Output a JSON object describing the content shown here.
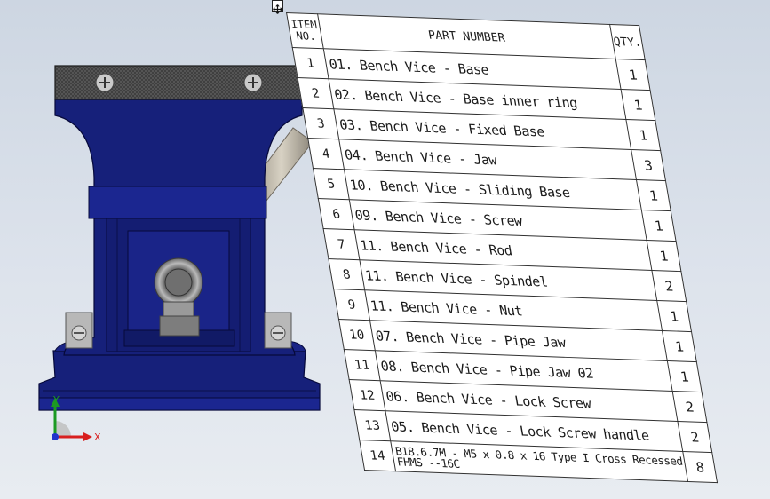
{
  "viewport": {
    "background": "#d8dfe8",
    "model_color": "#15207a",
    "axis_labels": {
      "x": "X",
      "y": "Y"
    },
    "axis_colors": {
      "x": "#d81f1f",
      "y": "#1c9a23",
      "z": "#2233cc"
    }
  },
  "bom": {
    "headers": {
      "item_line1": "ITEM",
      "item_line2": "NO.",
      "part": "PART NUMBER",
      "qty": "QTY."
    },
    "rows": [
      {
        "item": "1",
        "part": "01. Bench Vice - Base",
        "qty": "1"
      },
      {
        "item": "2",
        "part": "02. Bench Vice - Base inner ring",
        "qty": "1"
      },
      {
        "item": "3",
        "part": "03. Bench Vice - Fixed Base",
        "qty": "1"
      },
      {
        "item": "4",
        "part": "04. Bench Vice - Jaw",
        "qty": "3"
      },
      {
        "item": "5",
        "part": "10. Bench Vice - Sliding Base",
        "qty": "1"
      },
      {
        "item": "6",
        "part": "09. Bench Vice - Screw",
        "qty": "1"
      },
      {
        "item": "7",
        "part": "11. Bench Vice - Rod",
        "qty": "1"
      },
      {
        "item": "8",
        "part": "11. Bench Vice - Spindel",
        "qty": "2"
      },
      {
        "item": "9",
        "part": "11. Bench Vice - Nut",
        "qty": "1"
      },
      {
        "item": "10",
        "part": "07. Bench Vice - Pipe Jaw",
        "qty": "1"
      },
      {
        "item": "11",
        "part": "08. Bench Vice - Pipe Jaw 02",
        "qty": "1"
      },
      {
        "item": "12",
        "part": "06. Bench Vice - Lock Screw",
        "qty": "2"
      },
      {
        "item": "13",
        "part": "05. Bench Vice - Lock Screw handle",
        "qty": "2"
      },
      {
        "item": "14",
        "part": "B18.6.7M - M5 x 0.8 x 16 Type I Cross Recessed FHMS --16C",
        "qty": "8"
      }
    ]
  }
}
